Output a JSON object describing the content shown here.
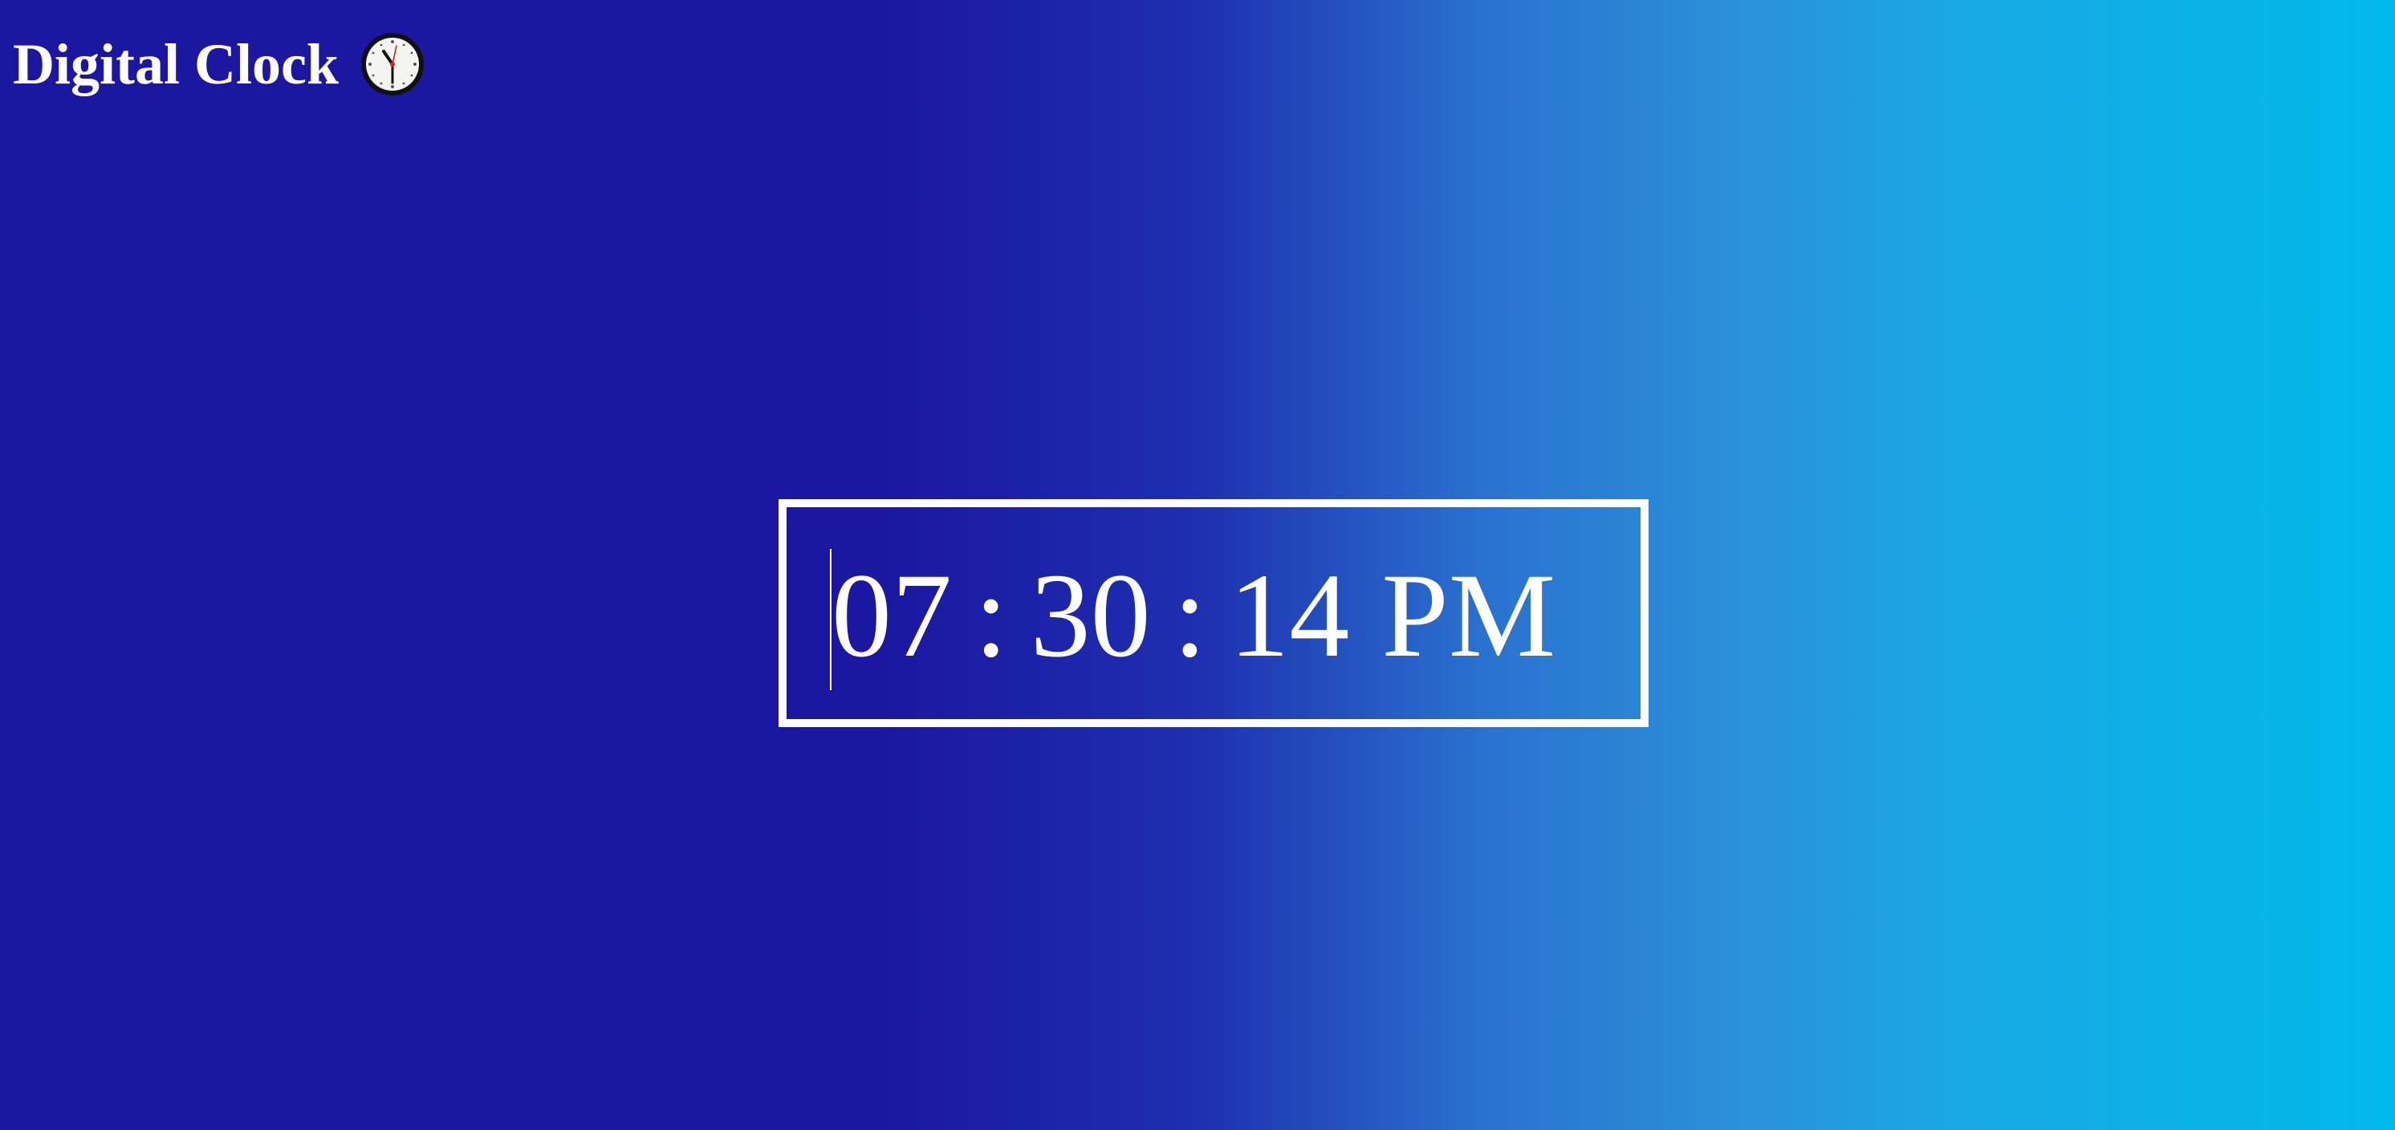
{
  "header": {
    "title": "Digital Clock",
    "icon": "wall-clock-icon"
  },
  "clock": {
    "hours": "07",
    "minutes": "30",
    "seconds": "14",
    "separator": ":",
    "meridiem": "PM"
  },
  "colors": {
    "background_start": "#1b17a0",
    "background_end": "#00b8ec",
    "text": "#ffffff",
    "border": "#ffffff"
  }
}
